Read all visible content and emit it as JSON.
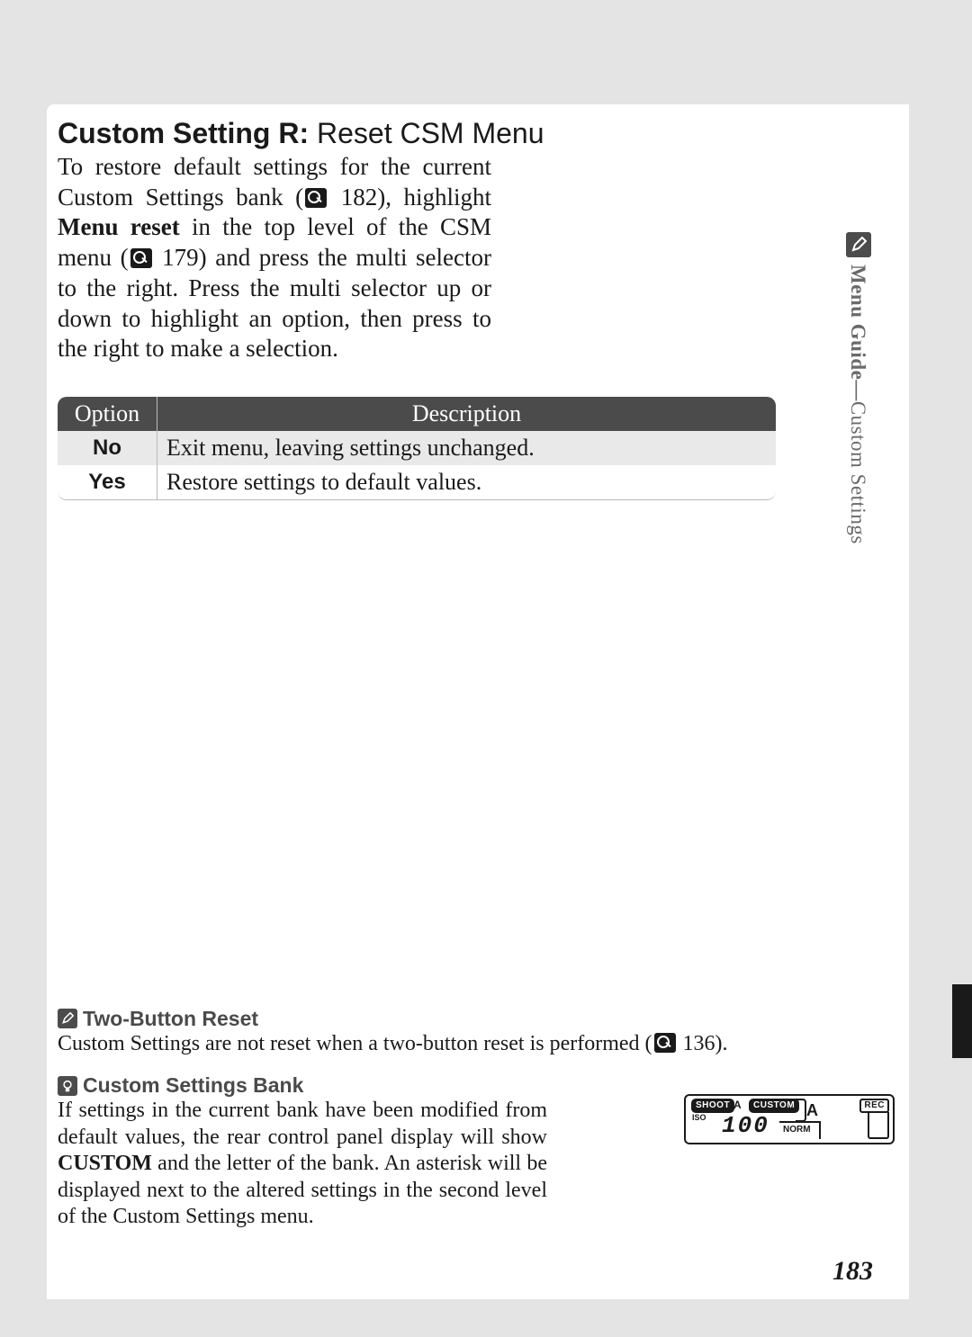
{
  "sidebar": {
    "icon": "pencil-icon",
    "label_bold": "Menu Guide—",
    "label_thin": "Custom Settings"
  },
  "heading": {
    "bold": "Custom Setting R:",
    "rest": " Reset CSM Menu"
  },
  "intro": {
    "l1a": "To restore default settings for the current Custom ",
    "l1b": "Settings bank (",
    "ref1": " 182), highlight ",
    "bold": "Menu reset",
    "l1c": " in the top level of the CSM menu (",
    "ref2": " 179) and press the multi selector to the right.  Press the multi selector up or down to highlight an option, then press to the right to make a selection."
  },
  "table": {
    "head": {
      "c1": "Option",
      "c2": "Description"
    },
    "rows": [
      {
        "opt": "No",
        "desc": "Exit menu, leaving settings unchanged."
      },
      {
        "opt": "Yes",
        "desc": "Restore settings to default values."
      }
    ]
  },
  "note1": {
    "icon": "pencil-icon",
    "title": "Two-Button Reset",
    "text_a": "Custom Settings are not reset when a two-button reset is performed (",
    "text_b": " 136)."
  },
  "note2": {
    "icon": "bulb-icon",
    "title": "Custom Settings Bank",
    "text_a": "If settings in the current bank have been modified from default values, the rear control panel display will show ",
    "bold": "CUSTOM",
    "text_b": " and the letter of the bank.  An asterisk will be displayed next to the altered settings in the second level of the Custom Settings menu."
  },
  "panel": {
    "shoot": "SHOOT",
    "shoot_letter": "A",
    "custom": "CUSTOM",
    "a": "A",
    "rec": "REC",
    "iso": "ISO",
    "num": "100",
    "norm": "NORM"
  },
  "page_number": "183"
}
